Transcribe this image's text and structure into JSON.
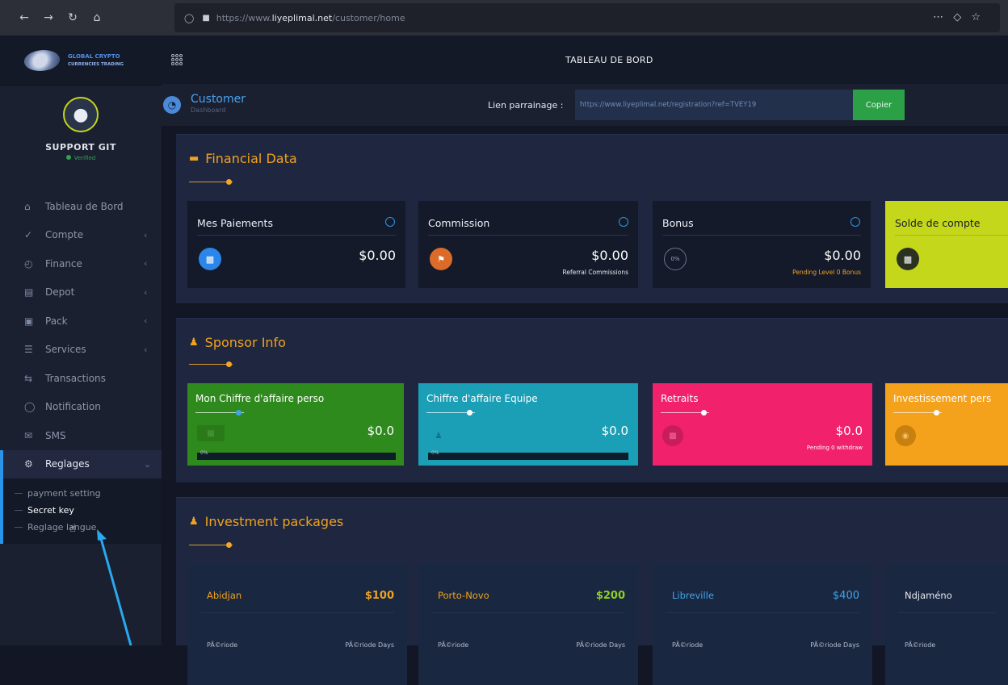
{
  "browser": {
    "url_prefix": "https://www.",
    "url_domain": "liyeplimal.net",
    "url_path": "/customer/home"
  },
  "brand": {
    "line1": "GLOBAL CRYPTO",
    "line2": "CURRENCIES TRADING"
  },
  "profile": {
    "name": "SUPPORT GIT",
    "status": "Verified"
  },
  "sidebar": {
    "items": [
      {
        "label": "Tableau de Bord",
        "icon": "home-icon",
        "has_chevron": false
      },
      {
        "label": "Compte",
        "icon": "check-icon",
        "has_chevron": true
      },
      {
        "label": "Finance",
        "icon": "clock-icon",
        "has_chevron": true
      },
      {
        "label": "Depot",
        "icon": "card-icon",
        "has_chevron": true
      },
      {
        "label": "Pack",
        "icon": "package-icon",
        "has_chevron": true
      },
      {
        "label": "Services",
        "icon": "list-icon",
        "has_chevron": true
      },
      {
        "label": "Transactions",
        "icon": "exchange-icon",
        "has_chevron": false
      },
      {
        "label": "Notification",
        "icon": "chat-icon",
        "has_chevron": false
      },
      {
        "label": "SMS",
        "icon": "mail-icon",
        "has_chevron": false
      },
      {
        "label": "Reglages",
        "icon": "gear-icon",
        "has_chevron": true
      }
    ],
    "sub_items": [
      "payment setting",
      "Secret key",
      "Reglage langue"
    ]
  },
  "header": {
    "title": "TABLEAU DE BORD"
  },
  "page": {
    "title": "Customer",
    "subtitle": "Dashboard"
  },
  "referral": {
    "label": "Lien parrainage :",
    "link": "https://www.liyeplimal.net/registration?ref=TVEY19",
    "copy_label": "Copier"
  },
  "financial": {
    "title": "Financial Data",
    "cards": [
      {
        "label": "Mes Paiements",
        "value": "$0.00",
        "sub": ""
      },
      {
        "label": "Commission",
        "value": "$0.00",
        "sub": "Referral Commissions"
      },
      {
        "label": "Bonus",
        "value": "$0.00",
        "sub": "Pending Level 0 Bonus",
        "badge": "0%"
      },
      {
        "label": "Solde de compte",
        "value": "",
        "sub": ""
      }
    ]
  },
  "sponsor": {
    "title": "Sponsor Info",
    "cards": [
      {
        "label": "Mon Chiffre d'affaire perso",
        "value": "$0.0",
        "sub": "",
        "progress": "0%"
      },
      {
        "label": "Chiffre d'affaire Equipe",
        "value": "$0.0",
        "sub": "",
        "progress": "0%"
      },
      {
        "label": "Retraits",
        "value": "$0.0",
        "sub": "Pending 0 withdraw"
      },
      {
        "label": "Investissement pers",
        "value": "",
        "sub": ""
      }
    ]
  },
  "packages": {
    "title": "Investment packages",
    "items": [
      {
        "name": "Abidjan",
        "price": "$100",
        "col1": "PÃ©riode",
        "col2": "PÃ©riode Days"
      },
      {
        "name": "Porto-Novo",
        "price": "$200",
        "col1": "PÃ©riode",
        "col2": "PÃ©riode Days"
      },
      {
        "name": "Libreville",
        "price": "$400",
        "col1": "PÃ©riode",
        "col2": "PÃ©riode Days"
      },
      {
        "name": "Ndjaméno",
        "price": "",
        "col1": "PÃ©riode",
        "col2": ""
      }
    ]
  },
  "colors": {
    "accent_orange": "#f0a21f",
    "accent_blue": "#2a95e8",
    "green": "#2f8a1d",
    "cyan": "#1a9fb7",
    "pink": "#f1216b",
    "lime": "#c4d71a",
    "amber": "#f4a11b"
  }
}
